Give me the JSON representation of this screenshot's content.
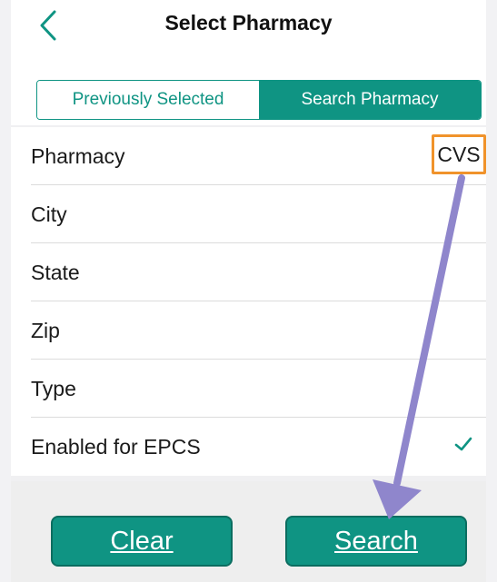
{
  "header": {
    "title": "Select Pharmacy",
    "back_icon": "chevron-left-icon"
  },
  "tabs": [
    {
      "label": "Previously Selected",
      "active": false
    },
    {
      "label": "Search Pharmacy",
      "active": true
    }
  ],
  "form": {
    "rows": [
      {
        "label": "Pharmacy",
        "value": "CVS"
      },
      {
        "label": "City",
        "value": ""
      },
      {
        "label": "State",
        "value": ""
      },
      {
        "label": "Zip",
        "value": ""
      },
      {
        "label": "Type",
        "value": ""
      },
      {
        "label": "Enabled for EPCS",
        "checked": true
      }
    ]
  },
  "buttons": {
    "clear": "Clear",
    "search": "Search"
  },
  "colors": {
    "accent": "#0f9483",
    "highlight_box": "#f0932b",
    "annotation_arrow": "#8f86cc"
  }
}
